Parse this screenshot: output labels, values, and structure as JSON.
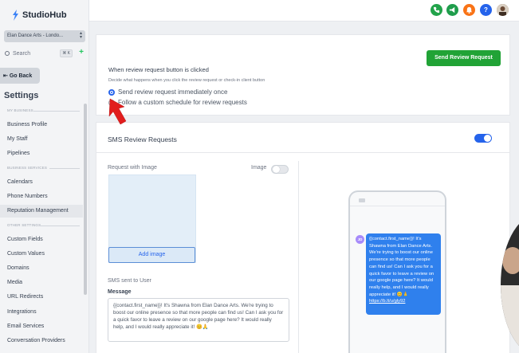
{
  "app": {
    "name": "StudioHub"
  },
  "sidebar": {
    "location": "Elan Dance Arts - Londo...",
    "search_placeholder": "Search",
    "search_shortcut": "⌘ K",
    "back_label": "Go Back",
    "title": "Settings",
    "sections": [
      {
        "label": "MY BUSINESS"
      },
      {
        "label": "BUSINESS SERVICES"
      },
      {
        "label": "OTHER SETTINGS"
      }
    ],
    "items": [
      {
        "label": "Business Profile"
      },
      {
        "label": "My Staff"
      },
      {
        "label": "Pipelines"
      },
      {
        "label": "Calendars"
      },
      {
        "label": "Phone Numbers"
      },
      {
        "label": "Reputation Management"
      },
      {
        "label": "Custom Fields"
      },
      {
        "label": "Custom Values"
      },
      {
        "label": "Domains"
      },
      {
        "label": "Media"
      },
      {
        "label": "URL Redirects"
      },
      {
        "label": "Integrations"
      },
      {
        "label": "Email Services"
      },
      {
        "label": "Conversation Providers"
      }
    ]
  },
  "topbar": {
    "icons": [
      "phone-icon",
      "megaphone-icon",
      "bell-icon",
      "help-icon",
      "user-avatar"
    ],
    "help_glyph": "?",
    "colors": {
      "phone": "#22a34a",
      "megaphone": "#1f9d4c",
      "bell": "#f97316",
      "help": "#2563eb"
    }
  },
  "request": {
    "button": "Send Review Request",
    "heading": "When review request button is clicked",
    "sub": "Decide what happens when you click the review request or check-in client button",
    "option1": "Send review request immediately once",
    "option2": "Follow a custom schedule for review requests"
  },
  "sms": {
    "title": "SMS Review Requests",
    "enabled": true,
    "request_with_image": "Request with Image",
    "image_toggle_label": "Image",
    "image_enabled": false,
    "add_image": "Add image",
    "sent_to_user": "SMS sent to User",
    "message_label": "Message",
    "message": "{{contact.first_name}}! It's Shawna from Elan Dance Arts. We're trying to boost our online presence so that more people can find us! Can I ask you for a quick favor to leave a review on our google page here? It would really help, and I would really appreciate it! 😊🙏"
  },
  "preview": {
    "avatar": "JD",
    "bubble_text": "{{contact.first_name}}! It's Shawna from Elan Dance Arts. We're trying to boost our online presence so that more people can find us! Can I ask you for a quick favor to leave a review on our google page here? It would really help, and I would really appreciate it! 😊🙏",
    "link": "https://b.lt/u/gly92"
  },
  "colors": {
    "accent": "#2563eb",
    "primary_button": "#21a336",
    "bubble": "#2f80ed",
    "toggle_on": "#2563eb"
  }
}
